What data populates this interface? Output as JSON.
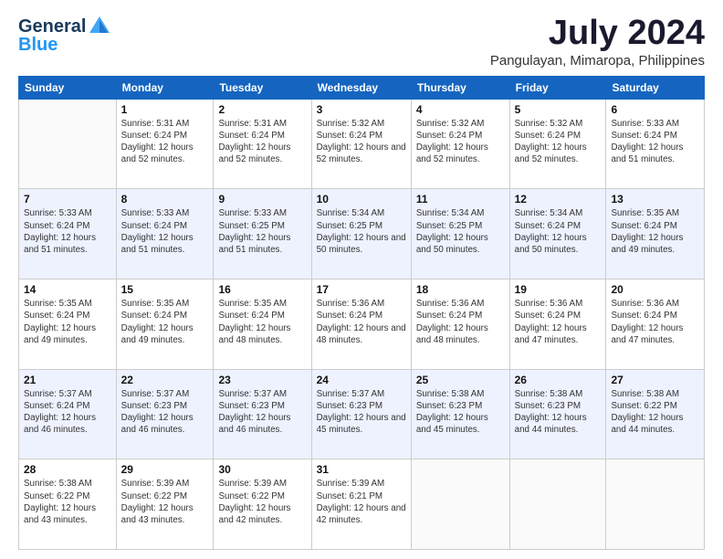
{
  "header": {
    "logo_line1": "General",
    "logo_line2": "Blue",
    "month": "July 2024",
    "location": "Pangulayan, Mimaropa, Philippines"
  },
  "days_of_week": [
    "Sunday",
    "Monday",
    "Tuesday",
    "Wednesday",
    "Thursday",
    "Friday",
    "Saturday"
  ],
  "weeks": [
    [
      {
        "day": "",
        "sunrise": "",
        "sunset": "",
        "daylight": ""
      },
      {
        "day": "1",
        "sunrise": "Sunrise: 5:31 AM",
        "sunset": "Sunset: 6:24 PM",
        "daylight": "Daylight: 12 hours and 52 minutes."
      },
      {
        "day": "2",
        "sunrise": "Sunrise: 5:31 AM",
        "sunset": "Sunset: 6:24 PM",
        "daylight": "Daylight: 12 hours and 52 minutes."
      },
      {
        "day": "3",
        "sunrise": "Sunrise: 5:32 AM",
        "sunset": "Sunset: 6:24 PM",
        "daylight": "Daylight: 12 hours and 52 minutes."
      },
      {
        "day": "4",
        "sunrise": "Sunrise: 5:32 AM",
        "sunset": "Sunset: 6:24 PM",
        "daylight": "Daylight: 12 hours and 52 minutes."
      },
      {
        "day": "5",
        "sunrise": "Sunrise: 5:32 AM",
        "sunset": "Sunset: 6:24 PM",
        "daylight": "Daylight: 12 hours and 52 minutes."
      },
      {
        "day": "6",
        "sunrise": "Sunrise: 5:33 AM",
        "sunset": "Sunset: 6:24 PM",
        "daylight": "Daylight: 12 hours and 51 minutes."
      }
    ],
    [
      {
        "day": "7",
        "sunrise": "Sunrise: 5:33 AM",
        "sunset": "Sunset: 6:24 PM",
        "daylight": "Daylight: 12 hours and 51 minutes."
      },
      {
        "day": "8",
        "sunrise": "Sunrise: 5:33 AM",
        "sunset": "Sunset: 6:24 PM",
        "daylight": "Daylight: 12 hours and 51 minutes."
      },
      {
        "day": "9",
        "sunrise": "Sunrise: 5:33 AM",
        "sunset": "Sunset: 6:25 PM",
        "daylight": "Daylight: 12 hours and 51 minutes."
      },
      {
        "day": "10",
        "sunrise": "Sunrise: 5:34 AM",
        "sunset": "Sunset: 6:25 PM",
        "daylight": "Daylight: 12 hours and 50 minutes."
      },
      {
        "day": "11",
        "sunrise": "Sunrise: 5:34 AM",
        "sunset": "Sunset: 6:25 PM",
        "daylight": "Daylight: 12 hours and 50 minutes."
      },
      {
        "day": "12",
        "sunrise": "Sunrise: 5:34 AM",
        "sunset": "Sunset: 6:24 PM",
        "daylight": "Daylight: 12 hours and 50 minutes."
      },
      {
        "day": "13",
        "sunrise": "Sunrise: 5:35 AM",
        "sunset": "Sunset: 6:24 PM",
        "daylight": "Daylight: 12 hours and 49 minutes."
      }
    ],
    [
      {
        "day": "14",
        "sunrise": "Sunrise: 5:35 AM",
        "sunset": "Sunset: 6:24 PM",
        "daylight": "Daylight: 12 hours and 49 minutes."
      },
      {
        "day": "15",
        "sunrise": "Sunrise: 5:35 AM",
        "sunset": "Sunset: 6:24 PM",
        "daylight": "Daylight: 12 hours and 49 minutes."
      },
      {
        "day": "16",
        "sunrise": "Sunrise: 5:35 AM",
        "sunset": "Sunset: 6:24 PM",
        "daylight": "Daylight: 12 hours and 48 minutes."
      },
      {
        "day": "17",
        "sunrise": "Sunrise: 5:36 AM",
        "sunset": "Sunset: 6:24 PM",
        "daylight": "Daylight: 12 hours and 48 minutes."
      },
      {
        "day": "18",
        "sunrise": "Sunrise: 5:36 AM",
        "sunset": "Sunset: 6:24 PM",
        "daylight": "Daylight: 12 hours and 48 minutes."
      },
      {
        "day": "19",
        "sunrise": "Sunrise: 5:36 AM",
        "sunset": "Sunset: 6:24 PM",
        "daylight": "Daylight: 12 hours and 47 minutes."
      },
      {
        "day": "20",
        "sunrise": "Sunrise: 5:36 AM",
        "sunset": "Sunset: 6:24 PM",
        "daylight": "Daylight: 12 hours and 47 minutes."
      }
    ],
    [
      {
        "day": "21",
        "sunrise": "Sunrise: 5:37 AM",
        "sunset": "Sunset: 6:24 PM",
        "daylight": "Daylight: 12 hours and 46 minutes."
      },
      {
        "day": "22",
        "sunrise": "Sunrise: 5:37 AM",
        "sunset": "Sunset: 6:23 PM",
        "daylight": "Daylight: 12 hours and 46 minutes."
      },
      {
        "day": "23",
        "sunrise": "Sunrise: 5:37 AM",
        "sunset": "Sunset: 6:23 PM",
        "daylight": "Daylight: 12 hours and 46 minutes."
      },
      {
        "day": "24",
        "sunrise": "Sunrise: 5:37 AM",
        "sunset": "Sunset: 6:23 PM",
        "daylight": "Daylight: 12 hours and 45 minutes."
      },
      {
        "day": "25",
        "sunrise": "Sunrise: 5:38 AM",
        "sunset": "Sunset: 6:23 PM",
        "daylight": "Daylight: 12 hours and 45 minutes."
      },
      {
        "day": "26",
        "sunrise": "Sunrise: 5:38 AM",
        "sunset": "Sunset: 6:23 PM",
        "daylight": "Daylight: 12 hours and 44 minutes."
      },
      {
        "day": "27",
        "sunrise": "Sunrise: 5:38 AM",
        "sunset": "Sunset: 6:22 PM",
        "daylight": "Daylight: 12 hours and 44 minutes."
      }
    ],
    [
      {
        "day": "28",
        "sunrise": "Sunrise: 5:38 AM",
        "sunset": "Sunset: 6:22 PM",
        "daylight": "Daylight: 12 hours and 43 minutes."
      },
      {
        "day": "29",
        "sunrise": "Sunrise: 5:39 AM",
        "sunset": "Sunset: 6:22 PM",
        "daylight": "Daylight: 12 hours and 43 minutes."
      },
      {
        "day": "30",
        "sunrise": "Sunrise: 5:39 AM",
        "sunset": "Sunset: 6:22 PM",
        "daylight": "Daylight: 12 hours and 42 minutes."
      },
      {
        "day": "31",
        "sunrise": "Sunrise: 5:39 AM",
        "sunset": "Sunset: 6:21 PM",
        "daylight": "Daylight: 12 hours and 42 minutes."
      },
      {
        "day": "",
        "sunrise": "",
        "sunset": "",
        "daylight": ""
      },
      {
        "day": "",
        "sunrise": "",
        "sunset": "",
        "daylight": ""
      },
      {
        "day": "",
        "sunrise": "",
        "sunset": "",
        "daylight": ""
      }
    ]
  ]
}
